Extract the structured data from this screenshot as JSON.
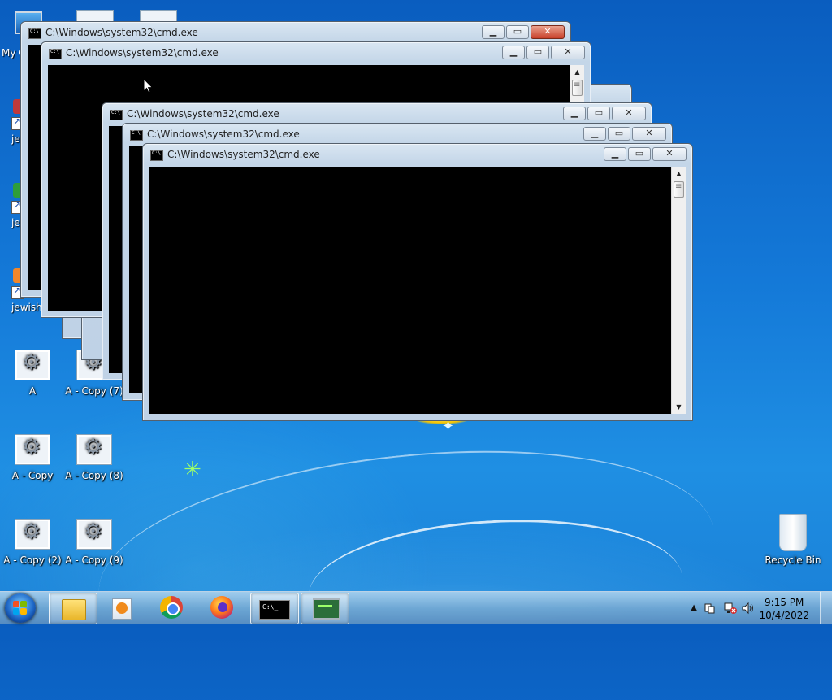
{
  "desktop": {
    "icons": [
      {
        "label": "A"
      },
      {
        "label": "A - Copy (7)"
      },
      {
        "label": "A - Copy"
      },
      {
        "label": "A - Copy (8)"
      },
      {
        "label": "A - Copy (2)"
      },
      {
        "label": "A - Copy (9)"
      }
    ],
    "partial_labels": {
      "my_computer": "My C",
      "jewish_1": "jew",
      "jewish_2": "jew",
      "jewish_3": "jewish"
    },
    "recycle_bin": "Recycle Bin"
  },
  "windows": [
    {
      "title": "C:\\Windows\\system32\\cmd.exe"
    },
    {
      "title": "C:\\Windows\\system32\\cmd.exe"
    },
    {
      "title": "C:\\Windows\\system32\\cmd.exe"
    },
    {
      "title": "C:\\Windows\\system32\\cmd.exe"
    },
    {
      "title": "C:\\Windows\\system32\\cmd.exe"
    }
  ],
  "window_controls": {
    "minimize": "▁",
    "maximize": "▭",
    "close": "✕"
  },
  "scrollbar": {
    "up": "▲",
    "down": "▼"
  },
  "taskbar": {
    "items": [
      {
        "name": "windows-explorer",
        "icon": "folder-icon"
      },
      {
        "name": "media-player",
        "icon": "media-icon"
      },
      {
        "name": "google-chrome",
        "icon": "chrome-icon"
      },
      {
        "name": "firefox",
        "icon": "firefox-icon"
      },
      {
        "name": "command-prompt",
        "icon": "cmd-icon"
      },
      {
        "name": "task-manager",
        "icon": "monitor-icon"
      }
    ],
    "clock": {
      "time": "9:15 PM",
      "date": "10/4/2022"
    },
    "tray": {
      "show_hidden": "▲"
    }
  }
}
